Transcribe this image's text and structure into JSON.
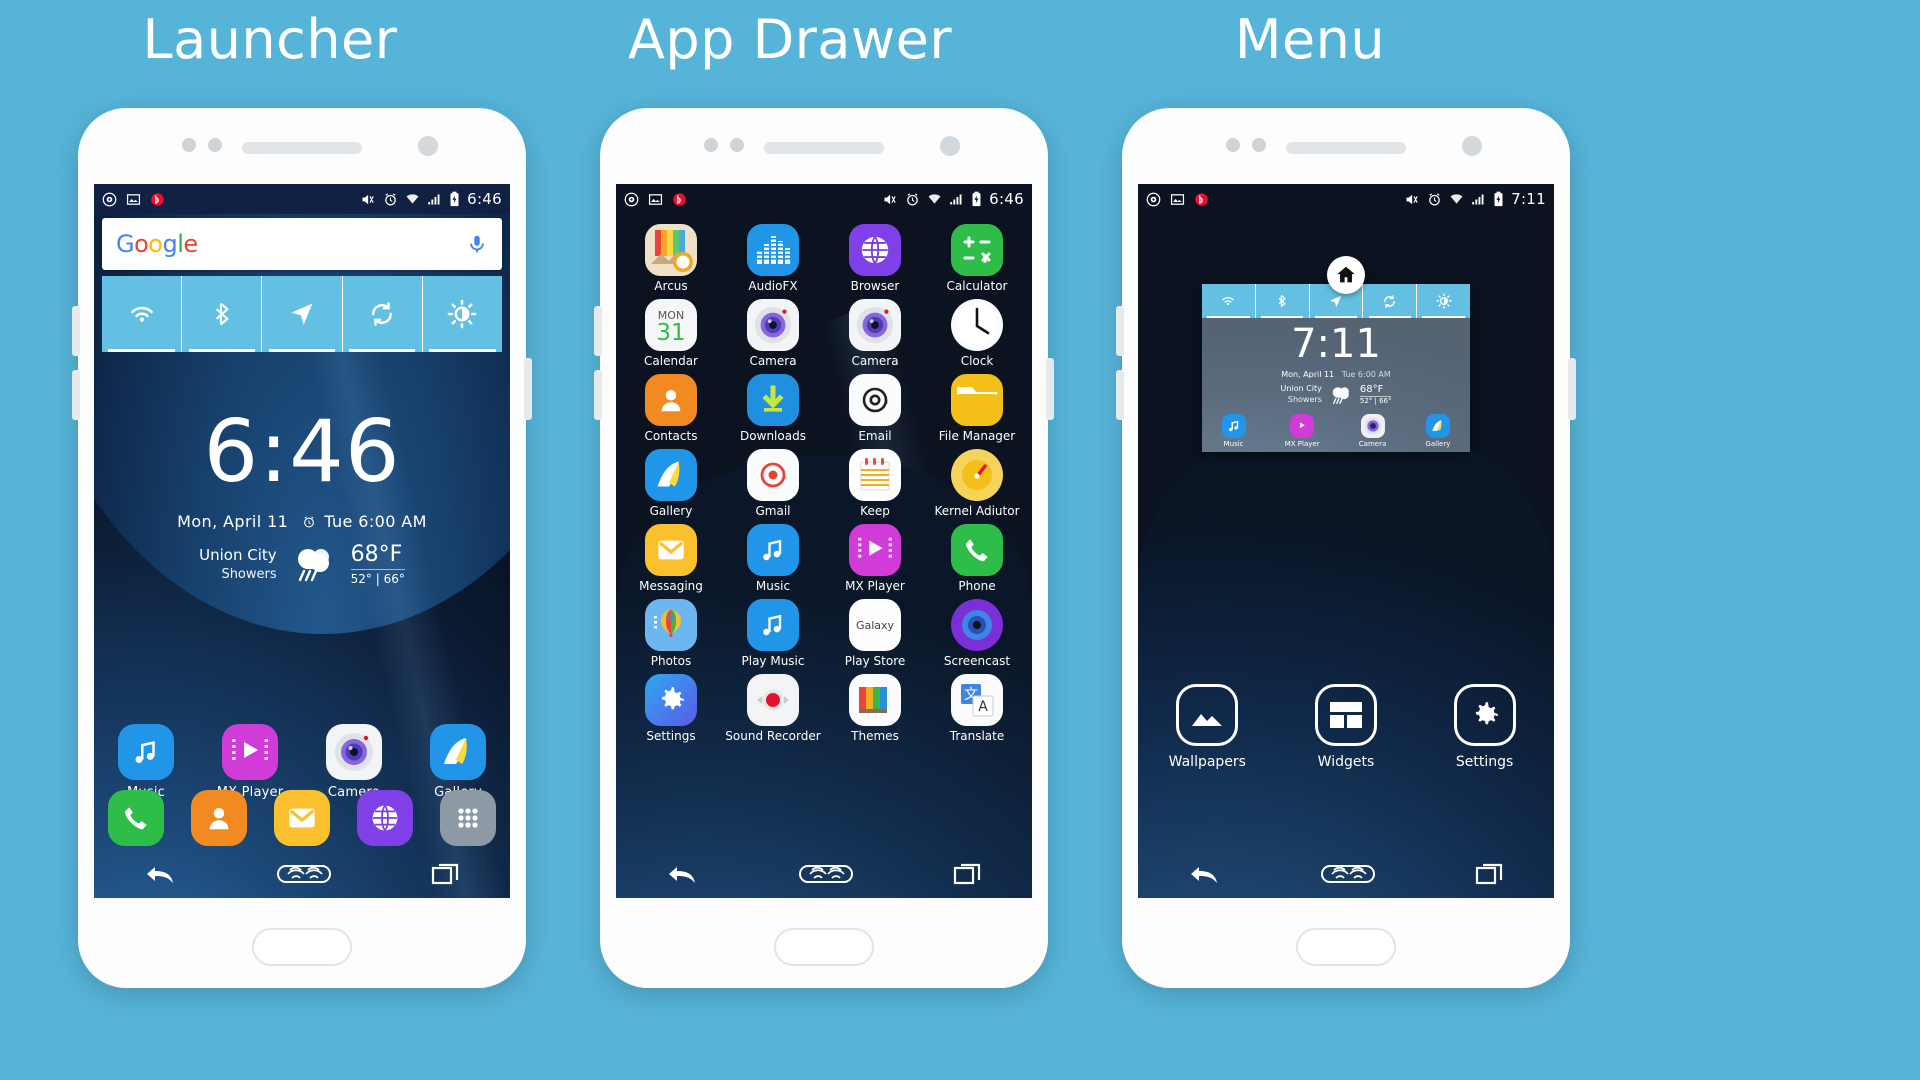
{
  "captions": {
    "launcher": "Launcher",
    "app_drawer": "App Drawer",
    "menu": "Menu"
  },
  "colors": {
    "background": "#56b4d8",
    "accent": "#63c0e2",
    "statusbar": "#112143",
    "drawer_bg": "#0b1220"
  },
  "launcher": {
    "statusbar": {
      "left_icons": [
        "disc-icon",
        "screenshot-icon",
        "beats-icon"
      ],
      "right_icons": [
        "vibrate-mute-icon",
        "alarm-icon",
        "wifi-icon",
        "signal-icon",
        "battery-charging-icon"
      ],
      "time": "6:46"
    },
    "search": {
      "logo": "Google",
      "mic_icon": "microphone-icon"
    },
    "toggles": [
      {
        "name": "wifi-toggle",
        "icon": "wifi-icon",
        "active": true
      },
      {
        "name": "bluetooth-toggle",
        "icon": "bluetooth-icon",
        "active": true
      },
      {
        "name": "location-toggle",
        "icon": "location-arrow-icon",
        "active": true
      },
      {
        "name": "sync-toggle",
        "icon": "sync-icon",
        "active": true
      },
      {
        "name": "brightness-toggle",
        "icon": "brightness-icon",
        "active": true
      }
    ],
    "clock_widget": {
      "time": "6:46",
      "date": "Mon, April 11",
      "alarm_icon": "alarm-clock-icon",
      "alarm": "Tue 6:00 AM",
      "city": "Union City",
      "condition": "Showers",
      "weather_icon": "rain-cloud-icon",
      "temp": "68°F",
      "low_high": "52° | 66°"
    },
    "apps": [
      {
        "label": "Music",
        "icon": "music-note-icon"
      },
      {
        "label": "MX Player",
        "icon": "mx-player-icon"
      },
      {
        "label": "Camera",
        "icon": "camera-icon"
      },
      {
        "label": "Gallery",
        "icon": "gallery-icon"
      }
    ],
    "dock": [
      {
        "label": "Phone",
        "icon": "phone-icon"
      },
      {
        "label": "Contacts",
        "icon": "contacts-icon"
      },
      {
        "label": "Messaging",
        "icon": "messaging-icon"
      },
      {
        "label": "Browser",
        "icon": "browser-icon"
      },
      {
        "label": "All Apps",
        "icon": "app-drawer-icon"
      }
    ],
    "navbar": [
      {
        "name": "back-button",
        "icon": "back-arrow-icon"
      },
      {
        "name": "home-button",
        "icon": "fingerprint-home-icon"
      },
      {
        "name": "recents-button",
        "icon": "recents-icon"
      }
    ]
  },
  "app_drawer": {
    "statusbar": {
      "left_icons": [
        "disc-icon",
        "screenshot-icon",
        "beats-icon"
      ],
      "right_icons": [
        "vibrate-mute-icon",
        "alarm-icon",
        "wifi-icon",
        "signal-icon",
        "battery-charging-icon"
      ],
      "time": "6:46"
    },
    "apps": [
      {
        "label": "Arcus",
        "icon": "arcus-icon"
      },
      {
        "label": "AudioFX",
        "icon": "audiofx-icon"
      },
      {
        "label": "Browser",
        "icon": "browser-icon"
      },
      {
        "label": "Calculator",
        "icon": "calculator-icon"
      },
      {
        "label": "Calendar",
        "icon": "calendar-icon",
        "day": "MON",
        "date": "31"
      },
      {
        "label": "Camera",
        "icon": "camera-icon"
      },
      {
        "label": "Camera",
        "icon": "camera-icon"
      },
      {
        "label": "Clock",
        "icon": "clock-icon"
      },
      {
        "label": "Contacts",
        "icon": "contacts-icon"
      },
      {
        "label": "Downloads",
        "icon": "downloads-icon"
      },
      {
        "label": "Email",
        "icon": "email-at-icon"
      },
      {
        "label": "File Manager",
        "icon": "folder-icon"
      },
      {
        "label": "Gallery",
        "icon": "gallery-icon"
      },
      {
        "label": "Gmail",
        "icon": "gmail-icon"
      },
      {
        "label": "Keep",
        "icon": "keep-notes-icon"
      },
      {
        "label": "Kernel Adiutor",
        "icon": "gauge-icon"
      },
      {
        "label": "Messaging",
        "icon": "messaging-icon"
      },
      {
        "label": "Music",
        "icon": "music-note-icon"
      },
      {
        "label": "MX Player",
        "icon": "mx-player-icon"
      },
      {
        "label": "Phone",
        "icon": "phone-icon"
      },
      {
        "label": "Photos",
        "icon": "photos-balloon-icon"
      },
      {
        "label": "Play Music",
        "icon": "play-music-icon"
      },
      {
        "label": "Play Store",
        "icon": "galaxy-store-icon"
      },
      {
        "label": "Screencast",
        "icon": "screencast-icon"
      },
      {
        "label": "Settings",
        "icon": "gear-icon"
      },
      {
        "label": "Sound Recorder",
        "icon": "record-icon"
      },
      {
        "label": "Themes",
        "icon": "themes-icon"
      },
      {
        "label": "Translate",
        "icon": "translate-icon"
      }
    ],
    "navbar": [
      {
        "name": "back-button",
        "icon": "back-arrow-icon"
      },
      {
        "name": "home-button",
        "icon": "fingerprint-home-icon"
      },
      {
        "name": "recents-button",
        "icon": "recents-icon"
      }
    ]
  },
  "menu": {
    "statusbar": {
      "left_icons": [
        "disc-icon",
        "screenshot-icon",
        "beats-icon"
      ],
      "right_icons": [
        "vibrate-mute-icon",
        "alarm-icon",
        "wifi-icon",
        "signal-icon",
        "battery-charging-icon"
      ],
      "time": "7:11"
    },
    "home_badge_icon": "home-icon",
    "preview": {
      "toggles": [
        {
          "name": "wifi-toggle",
          "icon": "wifi-icon",
          "active": true
        },
        {
          "name": "bluetooth-toggle",
          "icon": "bluetooth-icon",
          "active": true
        },
        {
          "name": "location-toggle",
          "icon": "location-arrow-icon",
          "active": true
        },
        {
          "name": "sync-toggle",
          "icon": "sync-icon",
          "active": true
        },
        {
          "name": "brightness-toggle",
          "icon": "brightness-icon",
          "active": true
        }
      ],
      "clock": {
        "time": "7:11",
        "date": "Mon, April 11",
        "alarm": "Tue 6:00 AM",
        "city": "Union City",
        "condition": "Showers",
        "temp": "68°F",
        "low_high": "52° | 66°"
      },
      "apps": [
        {
          "label": "Music",
          "icon": "music-note-icon"
        },
        {
          "label": "MX Player",
          "icon": "mx-player-icon"
        },
        {
          "label": "Camera",
          "icon": "camera-icon"
        },
        {
          "label": "Gallery",
          "icon": "gallery-icon"
        }
      ]
    },
    "options": [
      {
        "label": "Wallpapers",
        "icon": "wallpaper-image-icon"
      },
      {
        "label": "Widgets",
        "icon": "widgets-grid-icon"
      },
      {
        "label": "Settings",
        "icon": "gear-icon"
      }
    ],
    "navbar": [
      {
        "name": "back-button",
        "icon": "back-arrow-icon"
      },
      {
        "name": "home-button",
        "icon": "fingerprint-home-icon"
      },
      {
        "name": "recents-button",
        "icon": "recents-icon"
      }
    ]
  }
}
